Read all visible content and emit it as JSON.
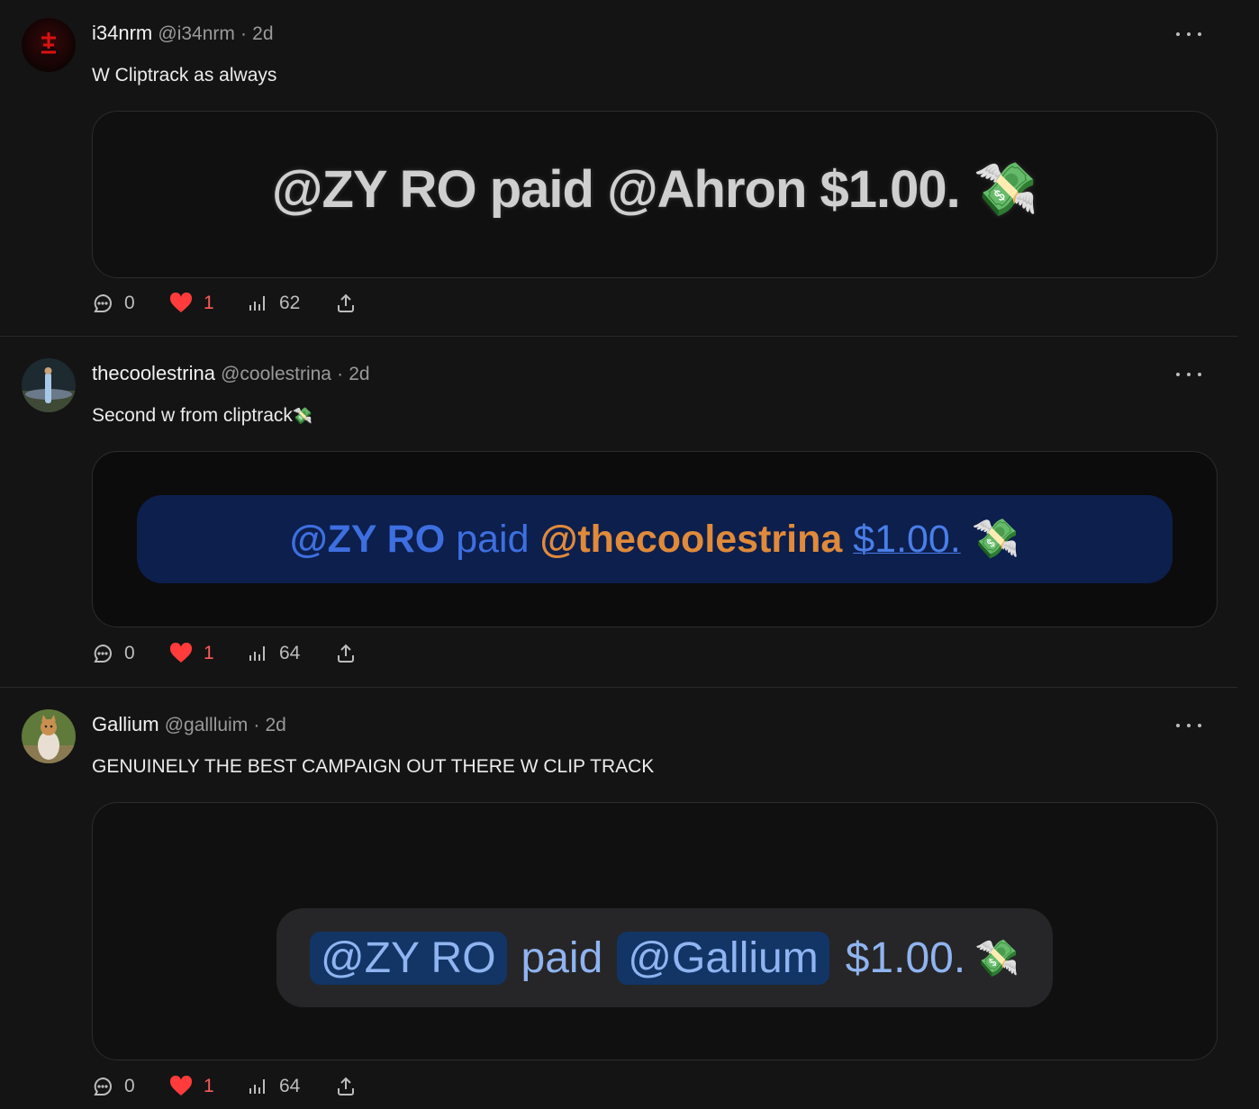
{
  "posts": [
    {
      "name": "i34nrm",
      "handle": "@i34nrm",
      "time": "2d",
      "text": "W Cliptrack as always",
      "image": {
        "before": "@ZY RO paid @Ahron $1.00.",
        "emoji": "💸"
      },
      "replies": "0",
      "likes": "1",
      "views": "62"
    },
    {
      "name": "thecoolestrina",
      "handle": "@coolestrina",
      "time": "2d",
      "text": "Second w from cliptrack",
      "text_emoji": "💸",
      "image": {
        "payer": "@ZY RO",
        "paid": "paid",
        "payee": "@thecoolestrina",
        "amount": "$1.00.",
        "emoji": "💸"
      },
      "replies": "0",
      "likes": "1",
      "views": "64"
    },
    {
      "name": "Gallium",
      "handle": "@gallluim",
      "time": "2d",
      "text": "GENUINELY THE BEST CAMPAIGN OUT THERE W CLIP TRACK",
      "image": {
        "payer": "@ZY RO",
        "paid": "paid",
        "payee": "@Gallium",
        "amount": "$1.00.",
        "emoji": "💸"
      },
      "replies": "0",
      "likes": "1",
      "views": "64"
    }
  ],
  "separator": "·",
  "colors": {
    "background": "#141414",
    "like": "#ff3b3b",
    "muted": "#9a9a9a",
    "card_border": "#2c2c2c"
  }
}
